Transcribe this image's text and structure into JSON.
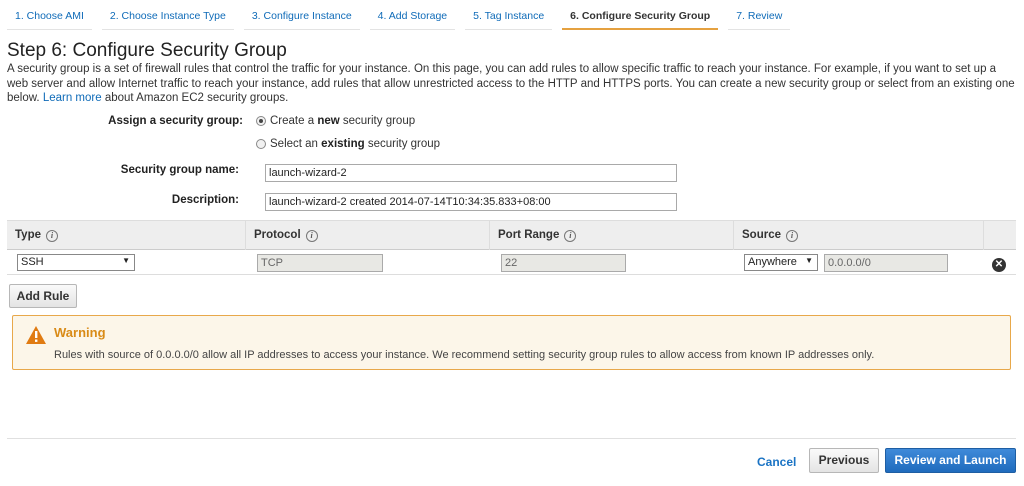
{
  "tabs": [
    {
      "label": "1. Choose AMI"
    },
    {
      "label": "2. Choose Instance Type"
    },
    {
      "label": "3. Configure Instance"
    },
    {
      "label": "4. Add Storage"
    },
    {
      "label": "5. Tag Instance"
    },
    {
      "label": "6. Configure Security Group"
    },
    {
      "label": "7. Review"
    }
  ],
  "page": {
    "title": "Step 6: Configure Security Group",
    "intro_text": "A security group is a set of firewall rules that control the traffic for your instance. On this page, you can add rules to allow specific traffic to reach your instance. For example, if you want to set up a web server and allow Internet traffic to reach your instance, add rules that allow unrestricted access to the HTTP and HTTPS ports. You can create a new security group or select from an existing one below.",
    "learn_more": "Learn more",
    "intro_suffix": "about Amazon EC2 security groups."
  },
  "form": {
    "assign_label": "Assign a security group:",
    "option_create": {
      "prefix": "Create a ",
      "bold": "new",
      "suffix": " security group",
      "checked": true
    },
    "option_existing": {
      "prefix": "Select an ",
      "bold": "existing",
      "suffix": " security group",
      "checked": false
    },
    "name_label": "Security group name:",
    "name_value": "launch-wizard-2",
    "description_label": "Description:",
    "description_value": "launch-wizard-2 created 2014-07-14T10:34:35.833+08:00"
  },
  "rules_table": {
    "headers": [
      "Type",
      "Protocol",
      "Port Range",
      "Source"
    ],
    "info_glyph": "i",
    "rows": [
      {
        "type": "SSH",
        "protocol": "TCP",
        "port_range": "22",
        "source_select": "Anywhere",
        "source_cidr": "0.0.0.0/0"
      }
    ],
    "remove_glyph": "✕"
  },
  "add_rule_label": "Add Rule",
  "warning": {
    "title": "Warning",
    "text": "Rules with source of 0.0.0.0/0 allow all IP addresses to access your instance. We recommend setting security group rules to allow access from known IP addresses only."
  },
  "footer": {
    "cancel": "Cancel",
    "previous": "Previous",
    "review_launch": "Review and Launch"
  },
  "colors": {
    "accent_link": "#0f6bb8",
    "active_tab_underline": "#e5a140",
    "warning_border": "#e8a84a",
    "primary_button": "#2a78c8"
  }
}
